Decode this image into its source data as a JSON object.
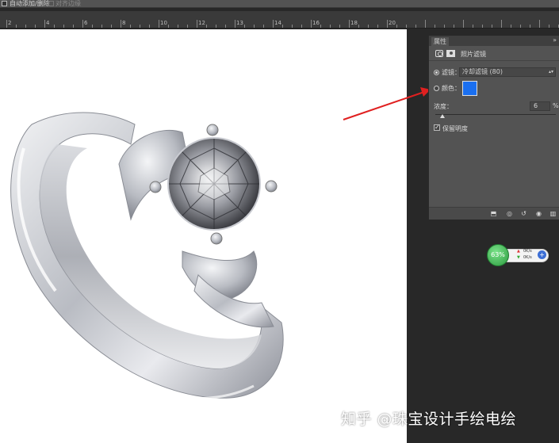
{
  "options_bar": {
    "auto_add_delete": "自动添加/删除",
    "align_edges": "对齐边缘"
  },
  "ruler": {
    "ticks": [
      "2",
      "4",
      "6",
      "8",
      "10",
      "12",
      "13",
      "14",
      "16",
      "18",
      "20"
    ]
  },
  "panel": {
    "tab_label": "属性",
    "collapse_glyph": "»",
    "title": "照片滤镜",
    "filter_label": "滤镜：",
    "filter_value": "冷却滤镜 (80)",
    "color_label": "颜色：",
    "color_swatch": "#1a6ff0",
    "density_label": "浓度：",
    "density_value": "6",
    "density_unit": "%",
    "density_level_percent": 6,
    "preserve_luminosity_label": "保留明度",
    "preserve_luminosity_checked": true,
    "filter_radio_selected": true
  },
  "network_widget": {
    "percent": "63%",
    "upload": "0K/s",
    "download": "0K/s"
  },
  "watermark": "知乎 @珠宝设计手绘电绘",
  "colors": {
    "accent_arrow": "#e02020",
    "panel_bg": "#535353",
    "workspace_bg": "#282828"
  }
}
